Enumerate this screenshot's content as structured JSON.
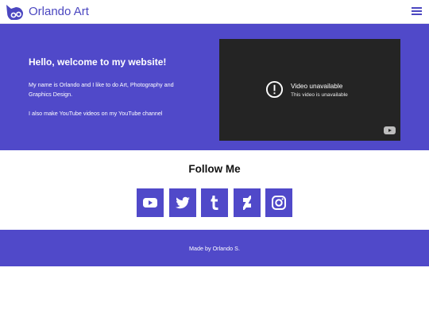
{
  "header": {
    "site_title": "Orlando Art",
    "logo_icon": "owl-logo-icon",
    "menu_icon": "hamburger-menu-icon"
  },
  "hero": {
    "title": "Hello, welcome to my website!",
    "paragraph_1": "My name is Orlando and I like to do Art, Photography and Graphics Design.",
    "paragraph_2": "I also make YouTube videos on my YouTube channel"
  },
  "video": {
    "title": "Video unavailable",
    "subtitle": "This video is unavailable",
    "alert_icon": "alert-circle-icon",
    "logo_icon": "youtube-logo-icon"
  },
  "follow": {
    "title": "Follow Me",
    "links": [
      {
        "icon": "youtube-icon"
      },
      {
        "icon": "twitter-icon"
      },
      {
        "icon": "tumblr-icon"
      },
      {
        "icon": "deviantart-icon"
      },
      {
        "icon": "instagram-icon"
      }
    ]
  },
  "footer": {
    "text": "Made by Orlando S."
  },
  "colors": {
    "brand": "#5049c9",
    "title": "#4b47c0",
    "video_bg": "#242424"
  }
}
